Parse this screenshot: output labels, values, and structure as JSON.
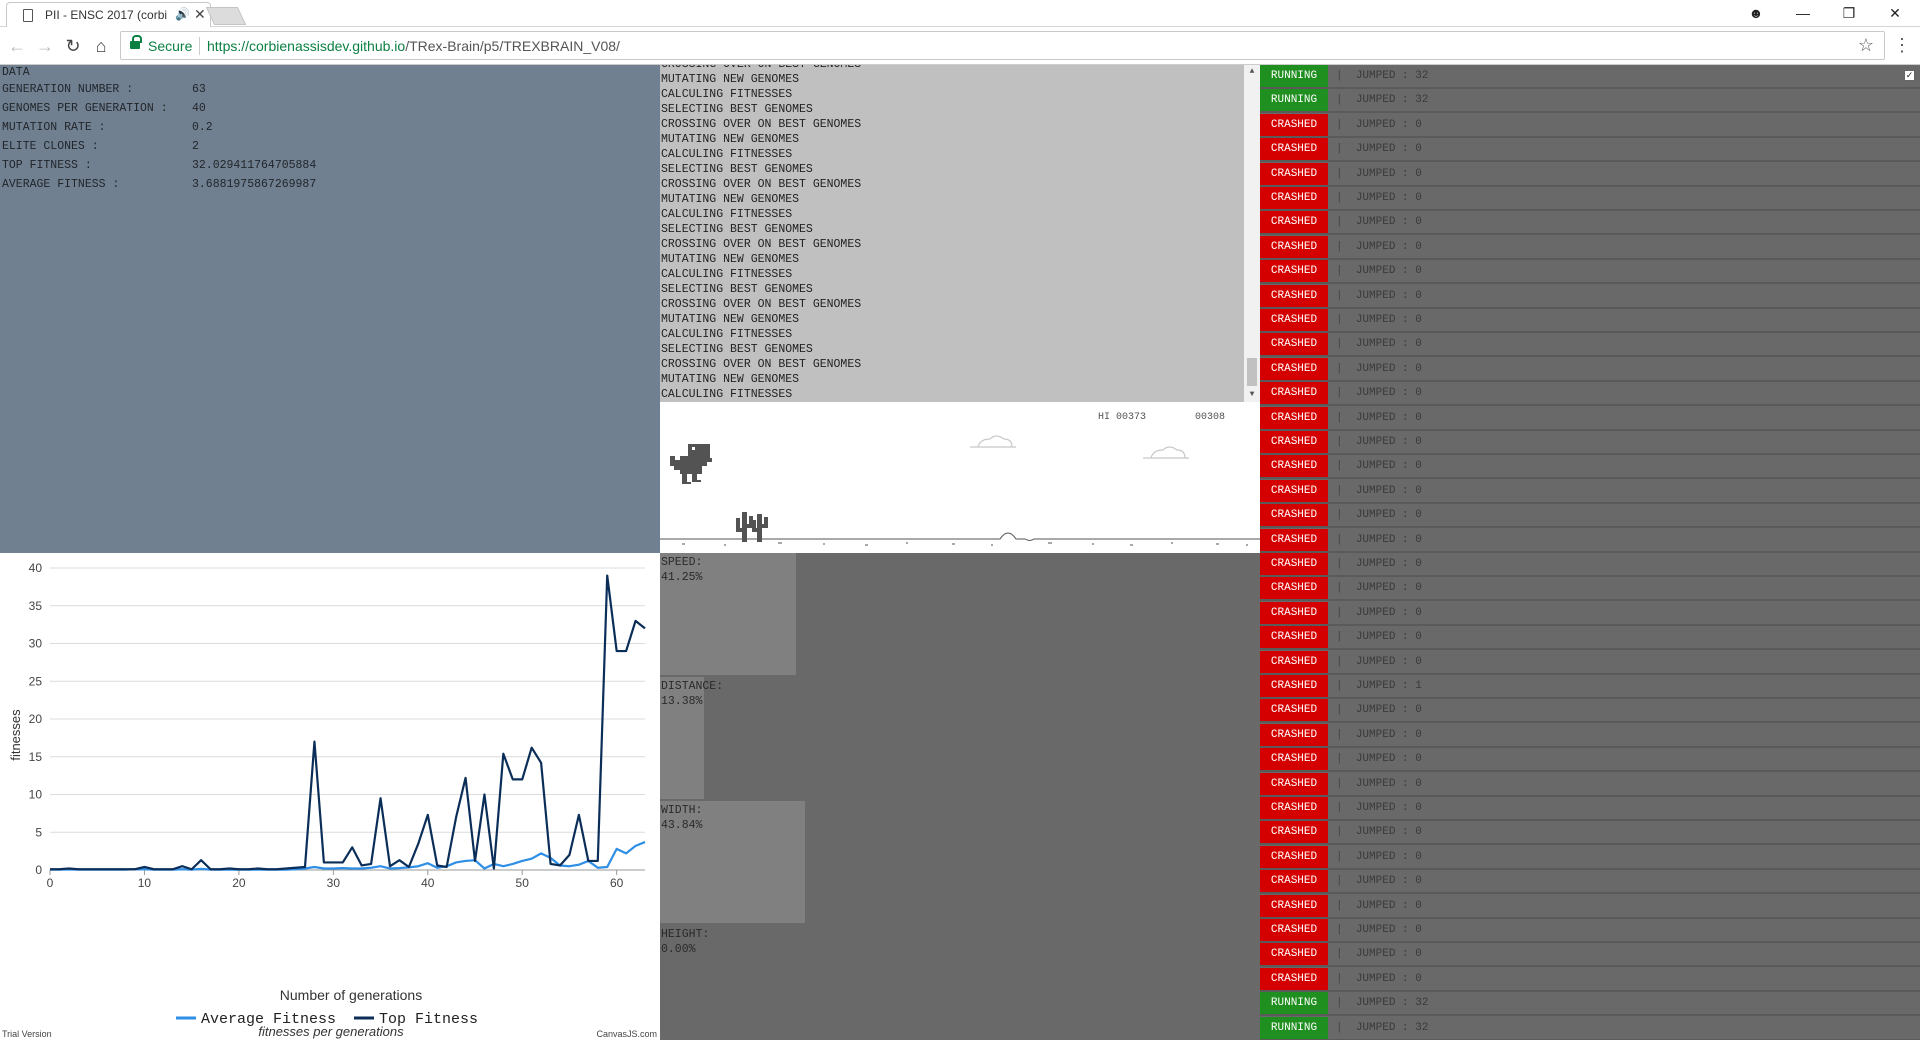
{
  "browser": {
    "tab_title": "PII - ENSC 2017 (corbi",
    "secure_label": "Secure",
    "url_host": "https://corbienassisdev.github.io",
    "url_path": "/TRex-Brain/p5/TREXBRAIN_V08/"
  },
  "data_panel": {
    "title": "DATA",
    "rows": [
      {
        "label": "GENERATION NUMBER :",
        "value": "63"
      },
      {
        "label": "GENOMES PER GENERATION :",
        "value": "40"
      },
      {
        "label": "MUTATION RATE :",
        "value": "0.2"
      },
      {
        "label": "ELITE CLONES :",
        "value": "2"
      },
      {
        "label": "TOP FITNESS :",
        "value": "32.029411764705884"
      },
      {
        "label": "AVERAGE FITNESS :",
        "value": "3.6881975867269987"
      }
    ]
  },
  "log": {
    "lines": [
      "CROSSING OVER ON BEST GENOMES",
      "MUTATING NEW GENOMES",
      "CALCULING FITNESSES",
      "SELECTING BEST GENOMES",
      "CROSSING OVER ON BEST GENOMES",
      "MUTATING NEW GENOMES",
      "CALCULING FITNESSES",
      "SELECTING BEST GENOMES",
      "CROSSING OVER ON BEST GENOMES",
      "MUTATING NEW GENOMES",
      "CALCULING FITNESSES",
      "SELECTING BEST GENOMES",
      "CROSSING OVER ON BEST GENOMES",
      "MUTATING NEW GENOMES",
      "CALCULING FITNESSES",
      "SELECTING BEST GENOMES",
      "CROSSING OVER ON BEST GENOMES",
      "MUTATING NEW GENOMES",
      "CALCULING FITNESSES",
      "SELECTING BEST GENOMES",
      "CROSSING OVER ON BEST GENOMES",
      "MUTATING NEW GENOMES",
      "CALCULING FITNESSES"
    ]
  },
  "game": {
    "hi_score": "HI 00373",
    "score": "00308"
  },
  "sensors": [
    {
      "label": "SPEED:",
      "value": "41.25%",
      "level": 0.4125
    },
    {
      "label": "DISTANCE:",
      "value": "13.38%",
      "level": 0.1338
    },
    {
      "label": "WIDTH:",
      "value": "43.84%",
      "level": 0.4384
    },
    {
      "label": "HEIGHT:",
      "value": "0.00%",
      "level": 0.0
    }
  ],
  "agents": {
    "jump_label": "JUMPED :",
    "items": [
      {
        "status": "RUNNING",
        "jumped": "32"
      },
      {
        "status": "RUNNING",
        "jumped": "32"
      },
      {
        "status": "CRASHED",
        "jumped": "0"
      },
      {
        "status": "CRASHED",
        "jumped": "0"
      },
      {
        "status": "CRASHED",
        "jumped": "0"
      },
      {
        "status": "CRASHED",
        "jumped": "0"
      },
      {
        "status": "CRASHED",
        "jumped": "0"
      },
      {
        "status": "CRASHED",
        "jumped": "0"
      },
      {
        "status": "CRASHED",
        "jumped": "0"
      },
      {
        "status": "CRASHED",
        "jumped": "0"
      },
      {
        "status": "CRASHED",
        "jumped": "0"
      },
      {
        "status": "CRASHED",
        "jumped": "0"
      },
      {
        "status": "CRASHED",
        "jumped": "0"
      },
      {
        "status": "CRASHED",
        "jumped": "0"
      },
      {
        "status": "CRASHED",
        "jumped": "0"
      },
      {
        "status": "CRASHED",
        "jumped": "0"
      },
      {
        "status": "CRASHED",
        "jumped": "0"
      },
      {
        "status": "CRASHED",
        "jumped": "0"
      },
      {
        "status": "CRASHED",
        "jumped": "0"
      },
      {
        "status": "CRASHED",
        "jumped": "0"
      },
      {
        "status": "CRASHED",
        "jumped": "0"
      },
      {
        "status": "CRASHED",
        "jumped": "0"
      },
      {
        "status": "CRASHED",
        "jumped": "0"
      },
      {
        "status": "CRASHED",
        "jumped": "0"
      },
      {
        "status": "CRASHED",
        "jumped": "0"
      },
      {
        "status": "CRASHED",
        "jumped": "1"
      },
      {
        "status": "CRASHED",
        "jumped": "0"
      },
      {
        "status": "CRASHED",
        "jumped": "0"
      },
      {
        "status": "CRASHED",
        "jumped": "0"
      },
      {
        "status": "CRASHED",
        "jumped": "0"
      },
      {
        "status": "CRASHED",
        "jumped": "0"
      },
      {
        "status": "CRASHED",
        "jumped": "0"
      },
      {
        "status": "CRASHED",
        "jumped": "0"
      },
      {
        "status": "CRASHED",
        "jumped": "0"
      },
      {
        "status": "CRASHED",
        "jumped": "0"
      },
      {
        "status": "CRASHED",
        "jumped": "0"
      },
      {
        "status": "CRASHED",
        "jumped": "0"
      },
      {
        "status": "CRASHED",
        "jumped": "0"
      },
      {
        "status": "RUNNING",
        "jumped": "32"
      },
      {
        "status": "RUNNING",
        "jumped": "32"
      }
    ]
  },
  "colors": {
    "running": "#1f8f1f",
    "crashed": "#d40000",
    "top_fitness": "#0b2e59",
    "average_fitness": "#2f8ee5"
  },
  "chart_data": {
    "type": "line",
    "title": "fitnesses per generations",
    "xlabel": "Number of generations",
    "ylabel": "fitnesses",
    "xlim": [
      0,
      63
    ],
    "ylim": [
      0,
      40
    ],
    "x_ticks": [
      0,
      10,
      20,
      30,
      40,
      50,
      60
    ],
    "y_ticks": [
      0,
      5,
      10,
      15,
      20,
      25,
      30,
      35,
      40
    ],
    "grid": "horizontal",
    "legend": "bottom",
    "x": [
      0,
      1,
      2,
      3,
      4,
      5,
      6,
      7,
      8,
      9,
      10,
      11,
      12,
      13,
      14,
      15,
      16,
      17,
      18,
      19,
      20,
      21,
      22,
      23,
      24,
      25,
      26,
      27,
      28,
      29,
      30,
      31,
      32,
      33,
      34,
      35,
      36,
      37,
      38,
      39,
      40,
      41,
      42,
      43,
      44,
      45,
      46,
      47,
      48,
      49,
      50,
      51,
      52,
      53,
      54,
      55,
      56,
      57,
      58,
      59,
      60,
      61,
      62,
      63
    ],
    "series": [
      {
        "name": "Average Fitness",
        "values": [
          0.05,
          0.05,
          0.08,
          0.05,
          0.05,
          0.05,
          0.05,
          0.05,
          0.05,
          0.1,
          0.12,
          0.05,
          0.05,
          0.05,
          0.1,
          0.05,
          0.15,
          0.05,
          0.05,
          0.05,
          0.05,
          0.05,
          0.05,
          0.05,
          0.05,
          0.05,
          0.1,
          0.2,
          0.4,
          0.2,
          0.2,
          0.25,
          0.2,
          0.2,
          0.3,
          0.5,
          0.2,
          0.25,
          0.35,
          0.5,
          0.9,
          0.3,
          0.5,
          1.0,
          1.2,
          1.3,
          0.2,
          0.8,
          0.5,
          0.8,
          1.2,
          1.5,
          2.2,
          1.6,
          0.6,
          0.5,
          0.7,
          1.2,
          0.3,
          0.4,
          2.8,
          2.2,
          3.2,
          3.7
        ]
      },
      {
        "name": "Top Fitness",
        "values": [
          0.1,
          0.1,
          0.2,
          0.1,
          0.1,
          0.1,
          0.1,
          0.1,
          0.1,
          0.1,
          0.4,
          0.1,
          0.1,
          0.1,
          0.5,
          0.1,
          1.3,
          0.1,
          0.1,
          0.2,
          0.1,
          0.1,
          0.2,
          0.1,
          0.1,
          0.2,
          0.3,
          0.4,
          17,
          1.0,
          1.0,
          1.0,
          3.0,
          0.6,
          0.8,
          9.5,
          0.5,
          1.3,
          0.4,
          3.5,
          7.3,
          0.6,
          0.4,
          7.0,
          12.2,
          1.2,
          10.0,
          0.2,
          15.4,
          12.0,
          12.0,
          16.2,
          14.2,
          0.8,
          0.6,
          2.0,
          7.3,
          1.2,
          1.2,
          39.0,
          29.0,
          29.0,
          33.0,
          32.0
        ]
      }
    ],
    "watermark_left": "Trial Version",
    "watermark_right": "CanvasJS.com"
  }
}
